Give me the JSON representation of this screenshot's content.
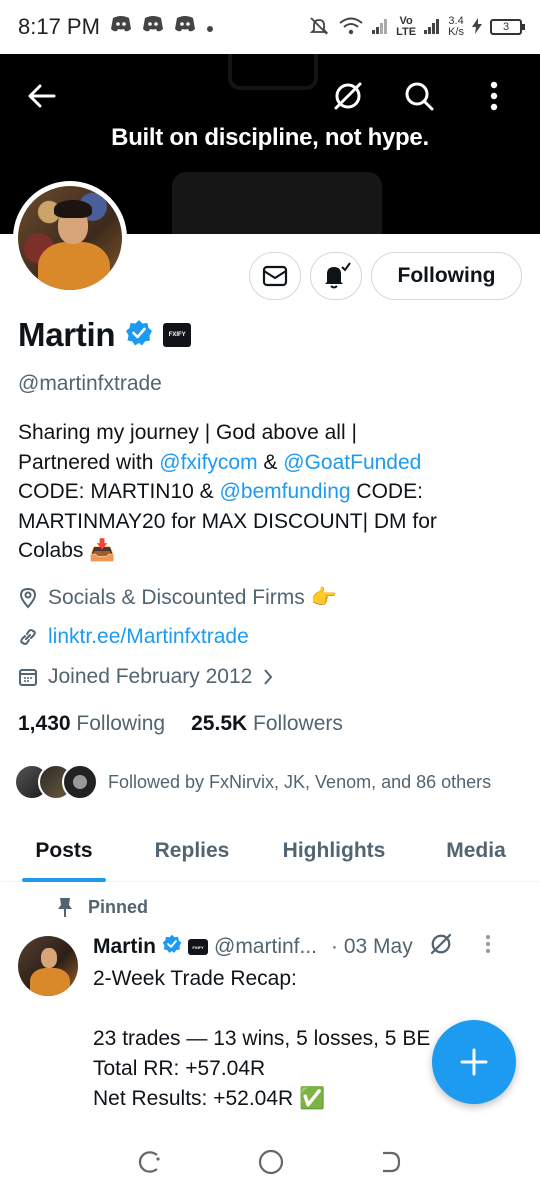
{
  "status_bar": {
    "time": "8:17 PM",
    "network_top": "Vo",
    "network_bottom": "LTE",
    "speed_value": "3.4",
    "speed_unit": "K/s",
    "battery": "3"
  },
  "banner": {
    "tagline": "Built on discipline, not hype."
  },
  "profile": {
    "follow_button": "Following",
    "display_name": "Martin",
    "affiliate_badge": "FXIFY",
    "handle": "@martinfxtrade",
    "bio": {
      "line1": "Sharing my journey | God above all |",
      "line2_pre": "Partnered with ",
      "line2_link1": "@fxifycom",
      "line2_mid": " & ",
      "line2_link2": "@GoatFunded",
      "line3_pre": "CODE: MARTIN10 & ",
      "line3_link": "@bemfunding",
      "line3_post": " CODE:",
      "line4": "MARTINMAY20 for MAX DISCOUNT| DM for",
      "line5": "Colabs 📥"
    },
    "location": "Socials & Discounted Firms 👉",
    "website": "linktr.ee/Martinfxtrade",
    "joined": "Joined February 2012",
    "following_count": "1,430",
    "following_label": "Following",
    "followers_count": "25.5K",
    "followers_label": "Followers",
    "followed_by": "Followed by FxNirvix, JK, Venom, and 86 others"
  },
  "tabs": [
    {
      "label": "Posts"
    },
    {
      "label": "Replies"
    },
    {
      "label": "Highlights"
    },
    {
      "label": "Media"
    }
  ],
  "post": {
    "pinned_label": "Pinned",
    "author": "Martin",
    "handle": "@martinf...",
    "date": "· 03 May",
    "body": "2-Week Trade Recap:\n\n23 trades — 13 wins, 5 losses, 5 BE\nTotal RR: +57.04R\nNet Results: +52.04R ✅"
  },
  "colors": {
    "accent": "#1d9bf0",
    "text": "#0f1419",
    "muted": "#536471",
    "border": "#cfd9de"
  }
}
